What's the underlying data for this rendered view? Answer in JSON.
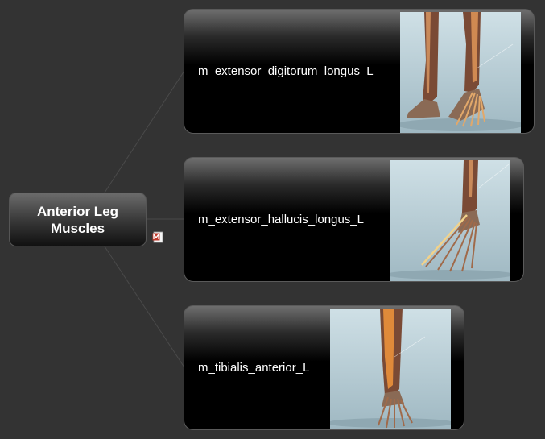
{
  "central_topic": {
    "line1": "Anterior Leg",
    "line2": "Muscles"
  },
  "note_icon": "notes-icon",
  "branches": [
    {
      "label": "m_extensor_digitorum_longus_L",
      "image": "leg-foot-muscle-illustration"
    },
    {
      "label": "m_extensor_hallucis_longus_L",
      "image": "foot-tendon-illustration"
    },
    {
      "label": "m_tibialis_anterior_L",
      "image": "shin-muscle-illustration"
    }
  ],
  "colors": {
    "background": "#333333",
    "node_fill": "#000000",
    "connector": "#4a4a4a",
    "text": "#ffffff",
    "thumb_bg": "#b9ced6",
    "muscle": "#c98a5a",
    "bone": "#7a5a45"
  }
}
